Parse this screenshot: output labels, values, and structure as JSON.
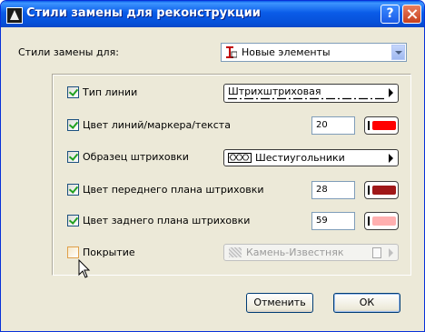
{
  "window": {
    "title": "Стили замены для реконструкции",
    "help_glyph": "?",
    "icon": "archicad-icon"
  },
  "top": {
    "label": "Стили замены для:",
    "select_value": "Новые элементы"
  },
  "rows": {
    "line_type": {
      "label": "Тип линии",
      "checked": true,
      "value": "Штрихштриховая"
    },
    "pen_color": {
      "label": "Цвет линий/маркера/текста",
      "checked": true,
      "pen": "20",
      "color": "#ff0000"
    },
    "fill_pattern": {
      "label": "Образец штриховки",
      "checked": true,
      "value": "Шестиугольники"
    },
    "fg_pen": {
      "label": "Цвет переднего плана штриховки",
      "checked": true,
      "pen": "28",
      "color": "#a01818"
    },
    "bg_pen": {
      "label": "Цвет заднего плана штриховки",
      "checked": true,
      "pen": "59",
      "color": "#ffb0b0"
    },
    "surface": {
      "label": "Покрытие",
      "checked": false,
      "value": "Камень-Известняк"
    }
  },
  "buttons": {
    "cancel": "Отменить",
    "ok": "ОК"
  },
  "colors": {
    "title_bar": "#0a5ce8",
    "dialog_bg": "#ece9d8"
  }
}
